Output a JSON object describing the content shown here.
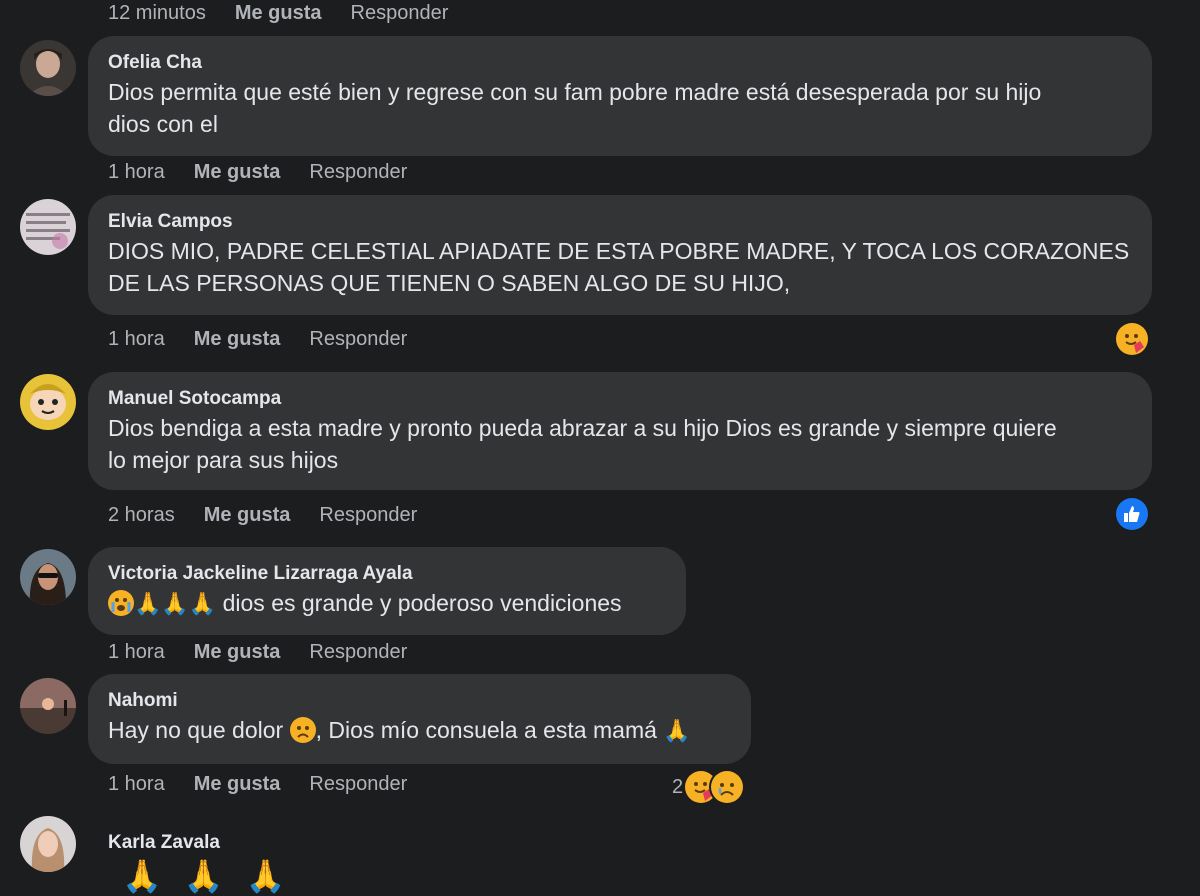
{
  "top_meta": {
    "time": "12 minutos",
    "like": "Me gusta",
    "reply": "Responder"
  },
  "comments": [
    {
      "author": "Ofelia Cha",
      "text_line1": "Dios permita que esté bien y regrese con su fam pobre madre está desesperada por su hijo",
      "text_line2": "dios con el",
      "time": "1 hora",
      "like": "Me gusta",
      "reply": "Responder"
    },
    {
      "author": "Elvia Campos",
      "text_line1": "DIOS MIO, PADRE CELESTIAL APIADATE DE ESTA POBRE MADRE, Y TOCA LOS CORAZONES",
      "text_line2": "DE LAS PERSONAS QUE TIENEN O SABEN ALGO DE SU HIJO,",
      "time": "1 hora",
      "like": "Me gusta",
      "reply": "Responder",
      "reactions": [
        "hug-reaction-icon"
      ]
    },
    {
      "author": "Manuel Sotocampa",
      "text_line1": "Dios bendiga a esta madre y pronto pueda abrazar a su hijo Dios es grande y siempre quiere",
      "text_line2": "lo mejor para sus hijos",
      "time": "2 horas",
      "like": "Me gusta",
      "reply": "Responder",
      "reactions": [
        "like-reaction-icon"
      ]
    },
    {
      "author": "Victoria Jackeline Lizarraga Ayala",
      "text_line1": "dios es grande y poderoso vendiciones",
      "time": "1 hora",
      "like": "Me gusta",
      "reply": "Responder"
    },
    {
      "author": "Nahomi",
      "text_part1": "Hay no que dolor ",
      "text_part2": ", Dios mío consuela a esta mamá ",
      "time": "1 hora",
      "like": "Me gusta",
      "reply": "Responder",
      "reaction_count": "2",
      "reactions": [
        "hug-reaction-icon",
        "sad-reaction-icon"
      ]
    },
    {
      "author": "Karla Zavala"
    }
  ],
  "colors": {
    "background": "#1c1d1f",
    "bubble": "#333436",
    "meta_text": "#b0b3b8",
    "text": "#e4e6eb",
    "like_blue": "#1877f2"
  }
}
